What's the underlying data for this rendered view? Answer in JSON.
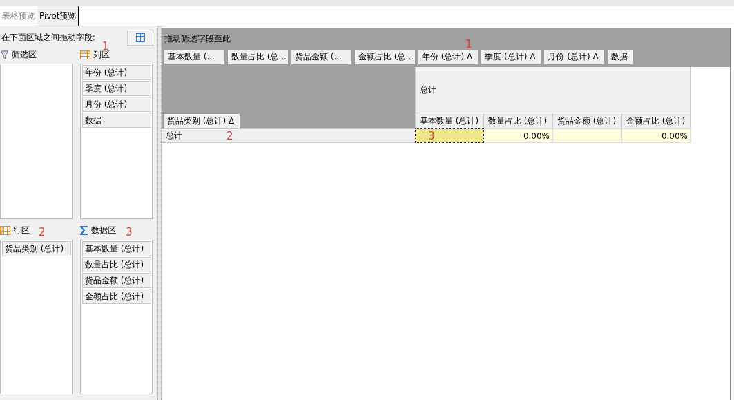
{
  "tabs": [
    {
      "label": "表格预览",
      "selected": false
    },
    {
      "label": "Pivot预览",
      "selected": true
    }
  ],
  "field_list": {
    "title": "在下面区域之间拖动字段:",
    "areas": [
      {
        "kind": "filter",
        "label": "筛选区"
      },
      {
        "kind": "column",
        "label": "列区",
        "note": "1",
        "fields": [
          "年份 (总计)",
          "季度 (总计)",
          "月份 (总计)",
          "数据"
        ]
      },
      {
        "kind": "row",
        "label": "行区",
        "note": "2",
        "fields": [
          "货品类别 (总计)"
        ]
      },
      {
        "kind": "data",
        "label": "数据区",
        "note": "3",
        "fields": [
          "基本数量 (总计)",
          "数量占比 (总计)",
          "货品金额 (总计)",
          "金额占比 (总计)"
        ]
      }
    ]
  },
  "pivot": {
    "filter_zone_label": "拖动筛选字段至此",
    "header_fields": [
      {
        "label": "基本数量 (..."
      },
      {
        "label": "数量占比 (总..."
      },
      {
        "label": "货品金额 (..."
      },
      {
        "label": "金额占比 (总..."
      },
      {
        "label": "年份 (总计) Δ",
        "note": "1"
      },
      {
        "label": "季度 (总计) Δ"
      },
      {
        "label": "月份 (总计) Δ"
      },
      {
        "label": "数据"
      }
    ],
    "column_header": "总计",
    "row_field": "货品类别 (总计)  Δ",
    "measures": [
      "基本数量 (总计)",
      "数量占比 (总计)",
      "货品金额 (总计)",
      "金额占比 (总计)"
    ],
    "rows": [
      {
        "label": "总计",
        "note": "2",
        "cells": [
          {
            "selected": true,
            "note": "3"
          },
          {
            "value": "0.00%",
            "selected": false
          },
          {
            "selected": false
          },
          {
            "value": "0.00%",
            "selected": false
          }
        ]
      }
    ]
  }
}
